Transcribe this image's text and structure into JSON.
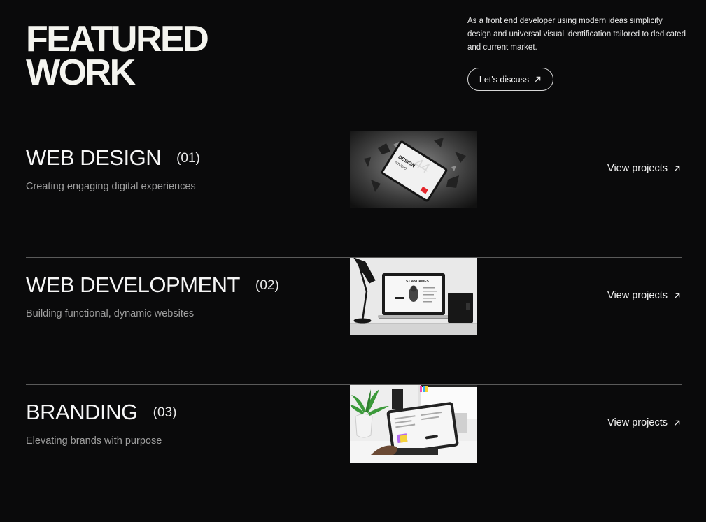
{
  "hero": {
    "title_line1": "FEATURED",
    "title_line2": "WORK",
    "intro": "As a front end developer using modern ideas simplicity design and universal visual identification tailored to dedicated and current market.",
    "discuss_label": "Let's discuss"
  },
  "services": [
    {
      "title": "WEB DESIGN",
      "number": "(01)",
      "description": "Creating engaging digital experiences",
      "thumb_text": "DESIGN",
      "link_label": "View projects"
    },
    {
      "title": "WEB DEVELOPMENT",
      "number": "(02)",
      "description": "Building functional, dynamic websites",
      "thumb_text": "ST ANDAMES",
      "link_label": "View projects"
    },
    {
      "title": "BRANDING",
      "number": "(03)",
      "description": "Elevating brands with purpose",
      "thumb_text": "",
      "link_label": "View projects"
    }
  ],
  "colors": {
    "background": "#0a0a0b",
    "text": "#f2f2f2",
    "muted": "#9e9e9e",
    "divider": "#5a5a5a"
  },
  "icons": {
    "arrow": "arrow-up-right-icon"
  }
}
